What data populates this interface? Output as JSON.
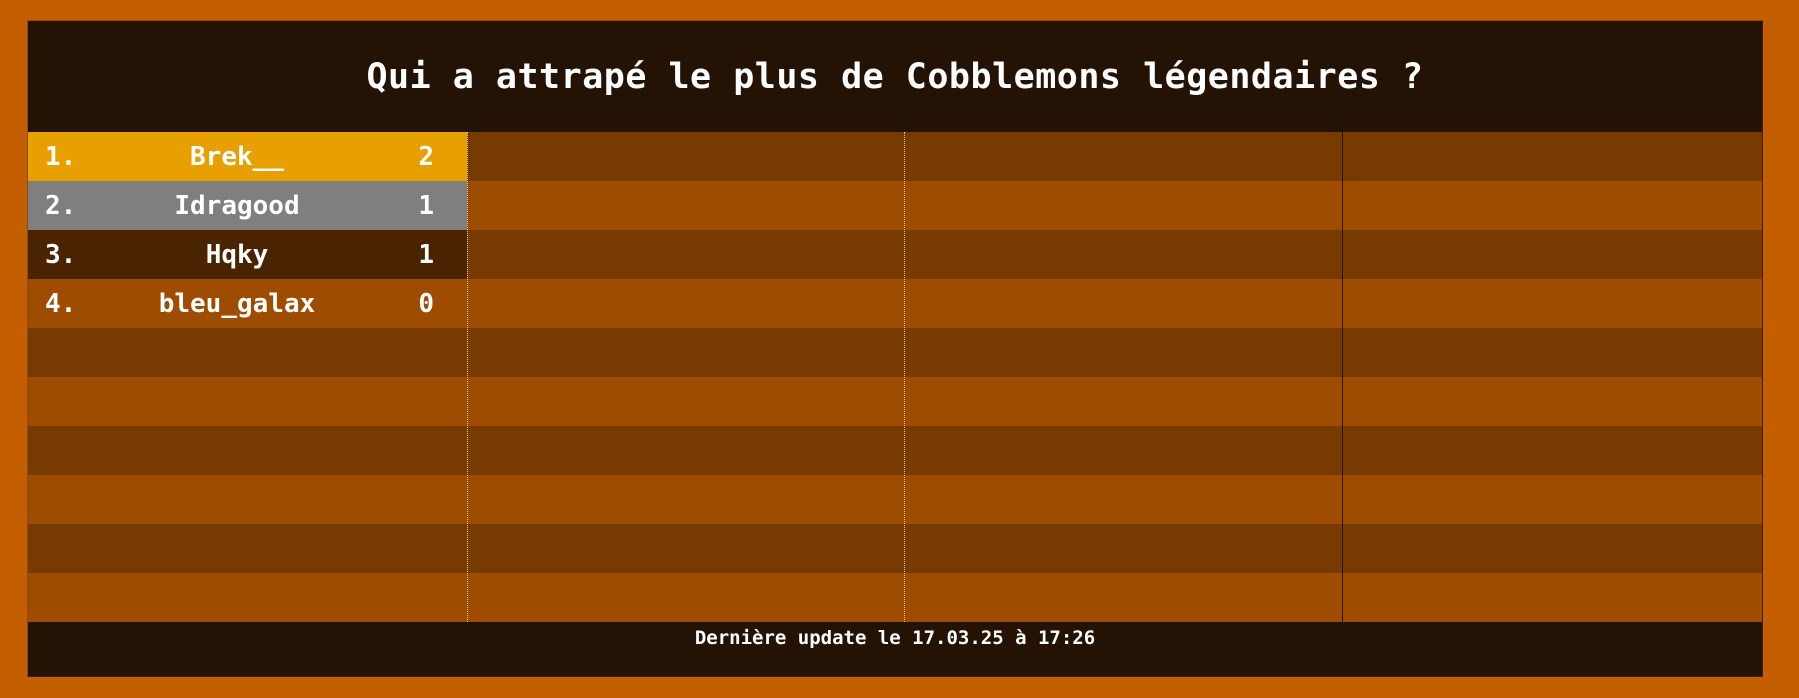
{
  "title": "Qui a attrapé le plus de Cobblemons légendaires ?",
  "leaderboard": {
    "entries": [
      {
        "rank": "1.",
        "name": "Brek__",
        "score": "2",
        "color": "#e8a000"
      },
      {
        "rank": "2.",
        "name": "Idragood",
        "score": "1",
        "color": "#7f7f7f"
      },
      {
        "rank": "3.",
        "name": "Hqky",
        "score": "1",
        "color": "#4a2300"
      },
      {
        "rank": "4.",
        "name": "bleu_galax",
        "score": "0",
        "color": "#9e4d00"
      }
    ]
  },
  "footer": {
    "text": "Dernière update le 17.03.25 à 17:26"
  },
  "colors": {
    "frame": "#c35f00",
    "panel": "#241304",
    "row_dark": "#773a00",
    "row_light": "#9e4d00",
    "gold": "#e8a000",
    "silver": "#7f7f7f",
    "bronze": "#4a2300"
  }
}
